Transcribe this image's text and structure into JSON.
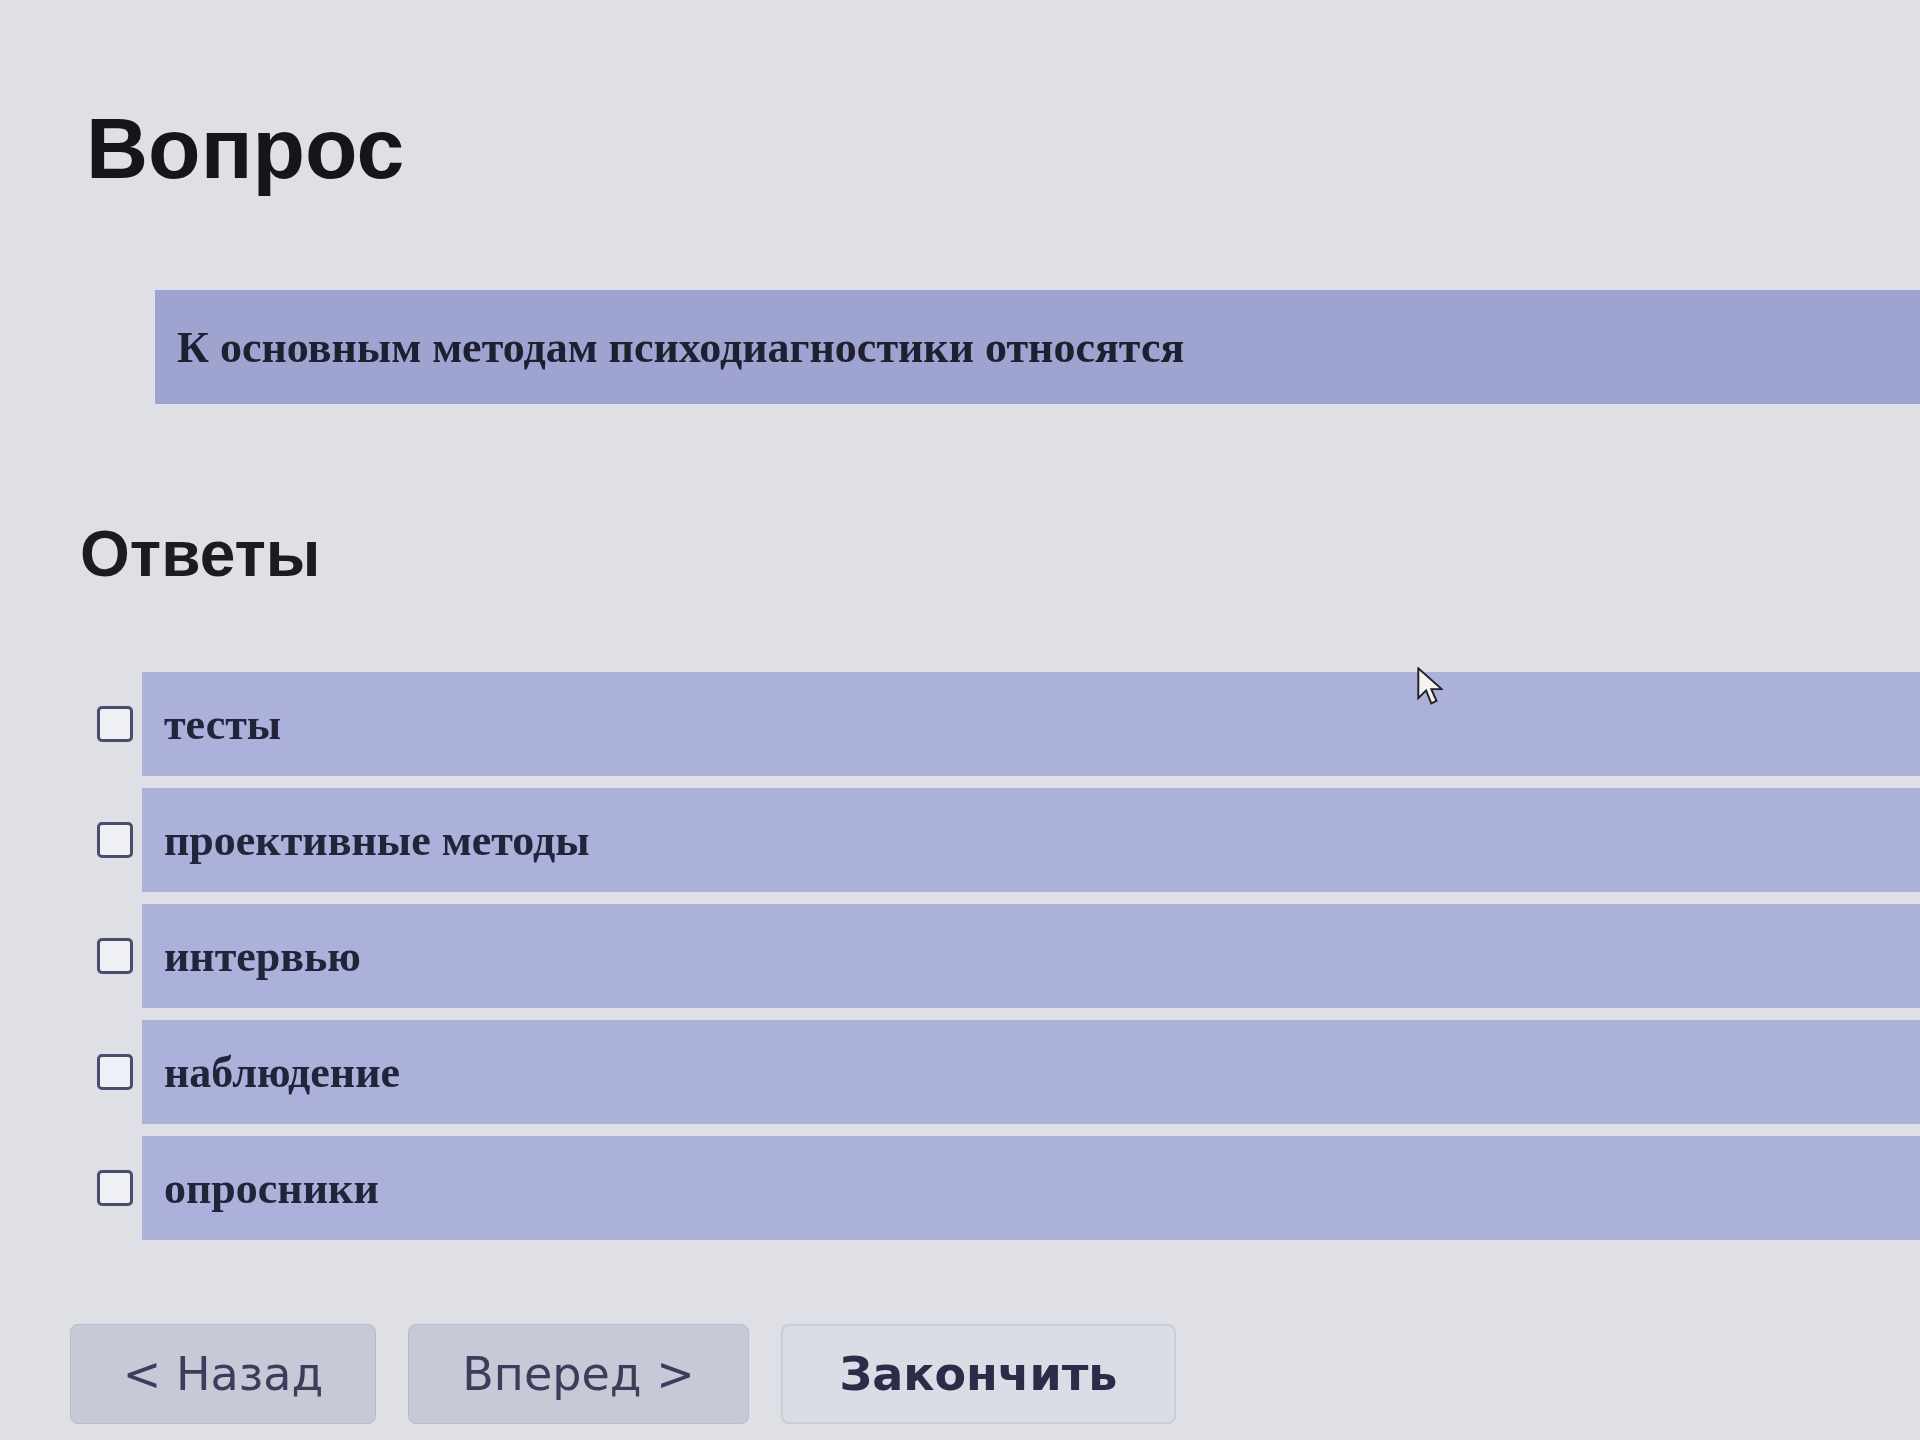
{
  "question_section": {
    "heading": "Вопрос",
    "text": "К основным методам психодиагностики относятся"
  },
  "answers_section": {
    "heading": "Ответы",
    "options": [
      {
        "label": "тесты",
        "checked": false
      },
      {
        "label": "проективные методы",
        "checked": false
      },
      {
        "label": "интервью",
        "checked": false
      },
      {
        "label": "наблюдение",
        "checked": false
      },
      {
        "label": "опросники",
        "checked": false
      }
    ]
  },
  "buttons": [
    {
      "label": "< Назад",
      "kind": "secondary"
    },
    {
      "label": "Вперед >",
      "kind": "secondary"
    },
    {
      "label": "Закончить",
      "kind": "primary"
    }
  ]
}
